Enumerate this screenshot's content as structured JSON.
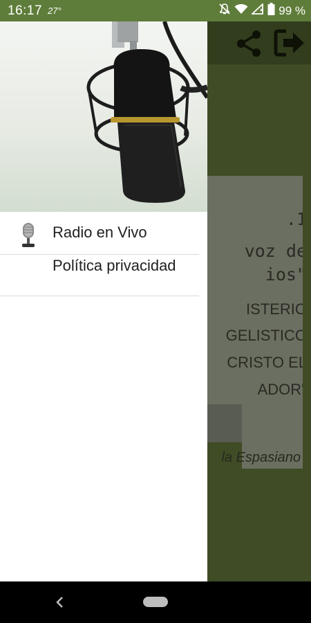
{
  "status_bar": {
    "time": "16:17",
    "temperature": "27°",
    "battery": "99 %",
    "icons": [
      "temperature-icon",
      "mute-icon",
      "wifi-icon",
      "signal-icon",
      "battery-icon"
    ]
  },
  "background_app": {
    "toolbar_icons": [
      "share-icon",
      "exit-icon"
    ],
    "card_lines": [
      ".1",
      "voz de",
      "ios\"",
      "ISTERIO",
      "GELISTICO",
      "CRISTO EL",
      "ADOR\""
    ],
    "author_fragment": "la Espasiano"
  },
  "drawer": {
    "header_image": "studio-microphone",
    "items": [
      {
        "label": "Radio en Vivo",
        "icon": "microphone-icon"
      },
      {
        "label": "Política privacidad",
        "icon": ""
      }
    ]
  },
  "nav_bar": {
    "buttons": [
      "back-button",
      "home-button"
    ]
  },
  "colors": {
    "status_bar": "#5f7d3a",
    "scrim_app_bar": "#323d1d",
    "scrim_content": "#3f4c25",
    "drawer_bg": "#ffffff"
  }
}
